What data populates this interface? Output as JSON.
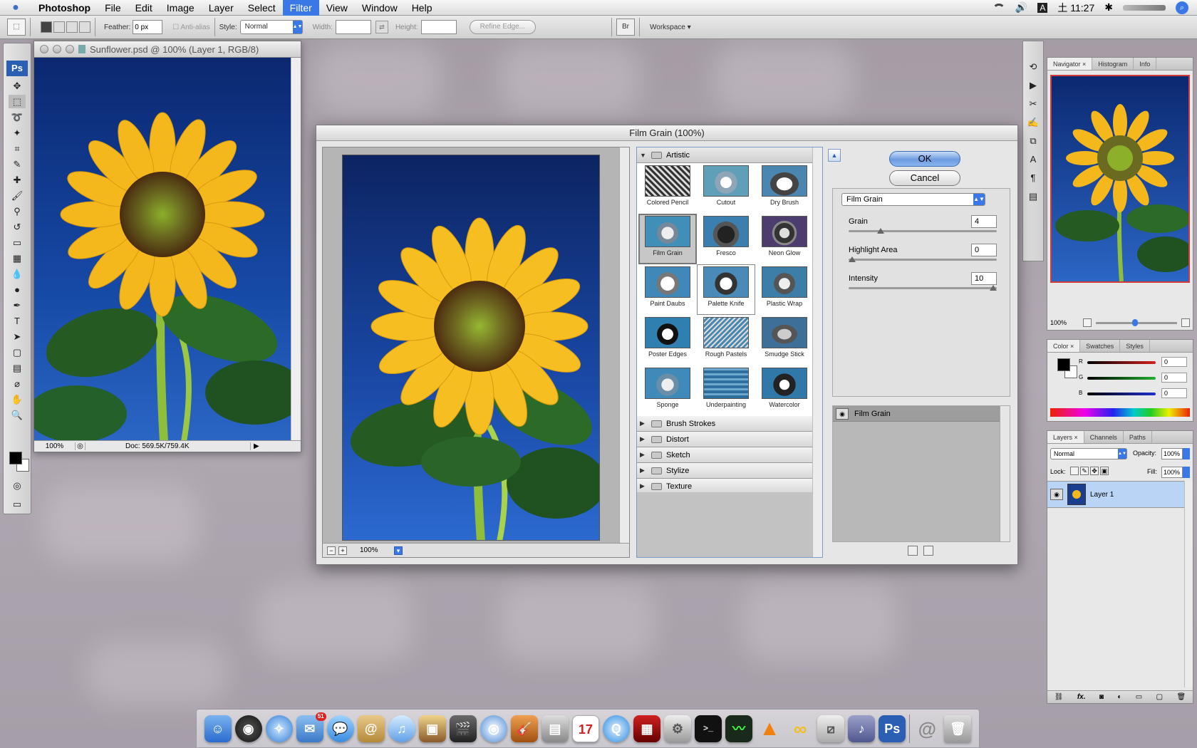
{
  "menubar": {
    "app": "Photoshop",
    "items": [
      "File",
      "Edit",
      "Image",
      "Layer",
      "Select",
      "Filter",
      "View",
      "Window",
      "Help"
    ],
    "active": "Filter",
    "clock": "土 11:27"
  },
  "optbar": {
    "feather_label": "Feather:",
    "feather_value": "0 px",
    "antialias": "Anti-alias",
    "style_label": "Style:",
    "style_value": "Normal",
    "width_label": "Width:",
    "height_label": "Height:",
    "refine": "Refine Edge...",
    "workspace": "Workspace ▾"
  },
  "document": {
    "title": "Sunflower.psd @ 100% (Layer 1, RGB/8)",
    "zoom": "100%",
    "doc_size": "Doc: 569.5K/759.4K"
  },
  "dialog": {
    "title": "Film Grain (100%)",
    "preview_zoom": "100%",
    "ok": "OK",
    "cancel": "Cancel",
    "filter_select": "Film Grain",
    "gallery": {
      "open_category": "Artistic",
      "thumbs": [
        "Colored Pencil",
        "Cutout",
        "Dry Brush",
        "Film Grain",
        "Fresco",
        "Neon Glow",
        "Paint Daubs",
        "Palette Knife",
        "Plastic Wrap",
        "Poster Edges",
        "Rough Pastels",
        "Smudge Stick",
        "Sponge",
        "Underpainting",
        "Watercolor"
      ],
      "selected": "Film Grain",
      "categories": [
        "Brush Strokes",
        "Distort",
        "Sketch",
        "Stylize",
        "Texture"
      ]
    },
    "params": [
      {
        "label": "Grain",
        "value": "4",
        "fraction": 0.2
      },
      {
        "label": "Highlight Area",
        "value": "0",
        "fraction": 0.0
      },
      {
        "label": "Intensity",
        "value": "10",
        "fraction": 1.0
      }
    ],
    "effect_layer": "Film Grain"
  },
  "navigator": {
    "tabs": [
      "Navigator",
      "Histogram",
      "Info"
    ],
    "zoom": "100%"
  },
  "color_panel": {
    "tabs": [
      "Color",
      "Swatches",
      "Styles"
    ],
    "channels": [
      {
        "label": "R",
        "value": "0",
        "color": "#d42020"
      },
      {
        "label": "G",
        "value": "0",
        "color": "#20b030"
      },
      {
        "label": "B",
        "value": "0",
        "color": "#2030d0"
      }
    ]
  },
  "layers_panel": {
    "tabs": [
      "Layers",
      "Channels",
      "Paths"
    ],
    "blend": "Normal",
    "opacity_label": "Opacity:",
    "opacity": "100%",
    "lock_label": "Lock:",
    "fill_label": "Fill:",
    "fill": "100%",
    "layer_name": "Layer 1",
    "fx": "fx."
  },
  "dock_badge": "51",
  "calendar_day": "17",
  "ps_label": "Ps"
}
